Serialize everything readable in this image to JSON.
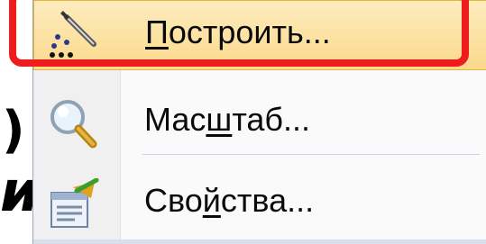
{
  "background": {
    "paren_text": ")",
    "italic_text": "и",
    "right_text": "="
  },
  "menu": {
    "items": [
      {
        "id": "build",
        "icon": "magic-wand-icon",
        "label_prefix": "",
        "label_mnemonic": "П",
        "label_suffix": "остроить...",
        "highlighted": true
      },
      {
        "id": "zoom",
        "icon": "magnifier-icon",
        "label_prefix": "Мас",
        "label_mnemonic": "ш",
        "label_suffix": "таб...",
        "highlighted": false
      },
      {
        "id": "properties",
        "icon": "properties-icon",
        "label_prefix": "Сво",
        "label_mnemonic": "й",
        "label_suffix": "ства...",
        "highlighted": false
      }
    ]
  },
  "colors": {
    "highlight_frame": "#ee1c1c",
    "hover_fill": "#fbd98d"
  }
}
